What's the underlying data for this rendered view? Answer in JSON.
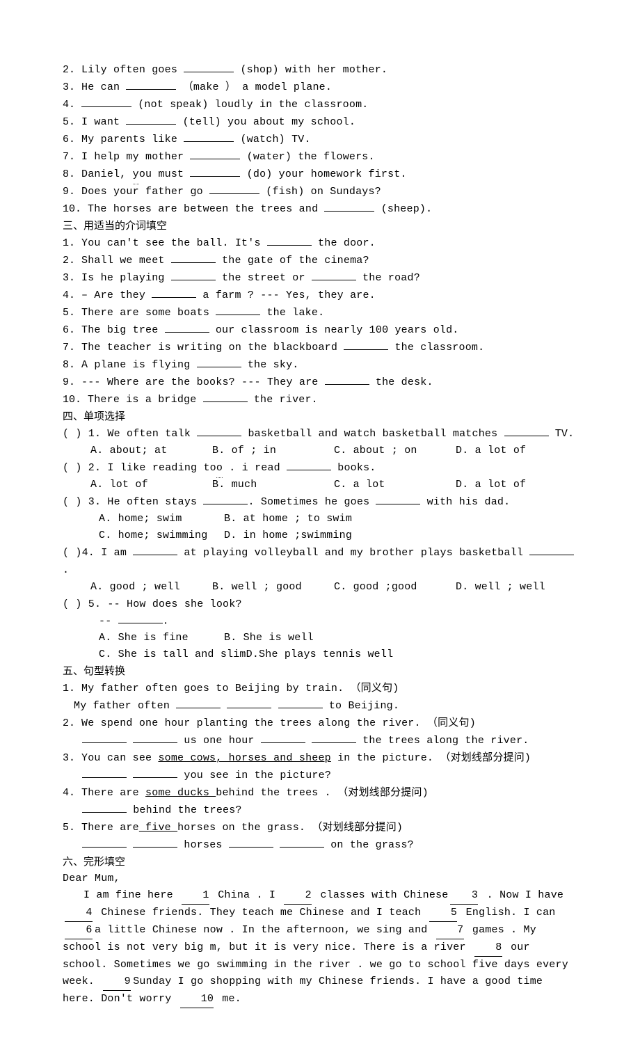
{
  "section2": {
    "items": [
      {
        "num": "2.",
        "before": "Lily often goes ",
        "hint": "(shop)",
        "after": " with her mother."
      },
      {
        "num": "3.",
        "before": "He can ",
        "hint": "（make ）",
        "after": " a model plane."
      },
      {
        "num": "4.",
        "before": "",
        "hint": "(not speak)",
        "after": " loudly in the classroom."
      },
      {
        "num": "5.",
        "before": "I want ",
        "hint": "(tell)",
        "after": " you about my school."
      },
      {
        "num": "6.",
        "before": "My parents like ",
        "hint": "(watch)",
        "after": " TV."
      },
      {
        "num": "7.",
        "before": "I help my mother ",
        "hint": "(water)",
        "after": " the flowers."
      },
      {
        "num": "8.",
        "before": "Daniel, you must ",
        "hint": "(do)",
        "after": " your homework first.",
        "dot": true
      },
      {
        "num": "9.",
        "before": "Does your father go ",
        "hint": "(fish)",
        "after": " on Sundays?"
      },
      {
        "num": "10.",
        "before": "The horses are between the trees and ",
        "hint": "(sheep).",
        "after": ""
      }
    ]
  },
  "section3": {
    "title": "三、用适当的介词填空",
    "items": [
      {
        "num": "1.",
        "parts": [
          "You can't see the ball. It's ",
          "_",
          " the door."
        ]
      },
      {
        "num": "2.",
        "parts": [
          "Shall we meet ",
          "_",
          " the gate of the cinema?"
        ]
      },
      {
        "num": "3.",
        "parts": [
          "Is he playing ",
          "_",
          " the street or ",
          "_",
          " the road?"
        ]
      },
      {
        "num": "4.",
        "parts": [
          "– Are they ",
          "_",
          " a farm ?      --- Yes, they are."
        ]
      },
      {
        "num": "5.",
        "parts": [
          "There are some boats ",
          "_",
          " the lake."
        ]
      },
      {
        "num": "6.",
        "parts": [
          "The big tree ",
          "_",
          " our classroom is nearly 100 years old."
        ]
      },
      {
        "num": "7.",
        "parts": [
          "The teacher is writing on the blackboard ",
          "_",
          " the classroom."
        ]
      },
      {
        "num": "8.",
        "parts": [
          "A plane is flying ",
          "_",
          " the sky."
        ]
      },
      {
        "num": "9.",
        "parts": [
          "--- Where are the books?      --- They are ",
          "_",
          " the desk."
        ]
      },
      {
        "num": "10.",
        "parts": [
          "There is a bridge ",
          "_",
          " the river."
        ]
      }
    ]
  },
  "section4": {
    "title": "四、单项选择",
    "items": [
      {
        "num": "( ) 1.",
        "q_parts": [
          "We often talk ",
          "_",
          " basketball and watch basketball matches ",
          "_",
          " TV."
        ],
        "opts": [
          "A. about; at",
          "B. of ; in",
          "C. about ; on",
          "D. a lot of"
        ]
      },
      {
        "num": "( ) 2.",
        "q_parts": [
          "I like reading too . i read ",
          "_",
          " books."
        ],
        "dot": true,
        "opts": [
          "A. lot of",
          "B. much",
          "C. a lot",
          "D. a lot of"
        ]
      },
      {
        "num": "( ) 3.",
        "q_parts": [
          "He often stays ",
          "_",
          ". Sometimes he goes ",
          "_",
          " with his dad."
        ],
        "opts2": [
          "A. home; swim",
          "B. at home ; to swim",
          "C. home; swimming",
          "D. in home ;swimming"
        ]
      },
      {
        "num": "( )4.",
        "q_parts": [
          "I am  ",
          "_",
          " at playing volleyball and my brother plays basketball ",
          "_",
          "."
        ],
        "opts": [
          "A. good ; well",
          "B. well ; good",
          "C. good ;good",
          "D. well ; well"
        ]
      },
      {
        "num": "( ) 5.",
        "q_parts": [
          "-- How does she look?"
        ],
        "q_extra": "-- _______.",
        "opts2": [
          "A. She is fine",
          "B. She is well",
          "C. She is tall and slim",
          "D.She plays tennis well"
        ]
      }
    ]
  },
  "section5": {
    "title": "五、句型转换",
    "items": [
      {
        "num": "1.",
        "line1": "My father often goes to Beijing by train. （同义句)",
        "line2_pre": "My father often ",
        "line2_tail": " to Beijing.",
        "blanks": 3,
        "indent": true
      },
      {
        "num": "2.",
        "line1": "We spend one hour planting the trees along the river. （同义句)",
        "line2_pre": "",
        "line2_mid": " us one hour ",
        "line2_tail": " the trees along the river.",
        "left_blanks": 2,
        "right_blanks": 2
      },
      {
        "num": "3.",
        "line1_pre": "You can see ",
        "line1_u": "some cows, horses and sheep",
        "line1_post": " in the picture.  （对划线部分提问)",
        "line2_pre": "",
        "line2_tail": " you see in the picture?",
        "blanks": 2
      },
      {
        "num": "4.",
        "line1_pre": "There are ",
        "line1_u": "some ducks ",
        "line1_post": "behind the trees . （对划线部分提问)",
        "line2_pre": "",
        "line2_tail": " behind the trees?",
        "blanks": 1
      },
      {
        "num": "5.",
        "line1_pre": "There are",
        "line1_u": " five ",
        "line1_post": "horses on the grass. （对划线部分提问)",
        "line2_pre": "",
        "line2_midA": " horses ",
        "line2_tail": " on the grass?",
        "left_blanks": 2,
        "right_blanks": 2
      }
    ]
  },
  "section6": {
    "title": "六、完形填空",
    "greeting": "Dear Mum,",
    "chunks": [
      "I am fine here ",
      "1",
      " China . I ",
      "2",
      " classes with Chinese",
      "3",
      " . Now I have ",
      "4",
      " Chinese friends. They teach me Chinese and I teach ",
      "5",
      " English. I can",
      "6",
      "a little Chinese now . In  the afternoon, we sing and ",
      "7",
      " games . My school is not very big m, but it is very nice. There is a river ",
      "8",
      " our school. Sometimes we go swimming in the river . we go to school five days every week. ",
      "9",
      "Sunday I go shopping with my Chinese friends. I have a good time here. Don't worry ",
      "10",
      " me."
    ]
  }
}
